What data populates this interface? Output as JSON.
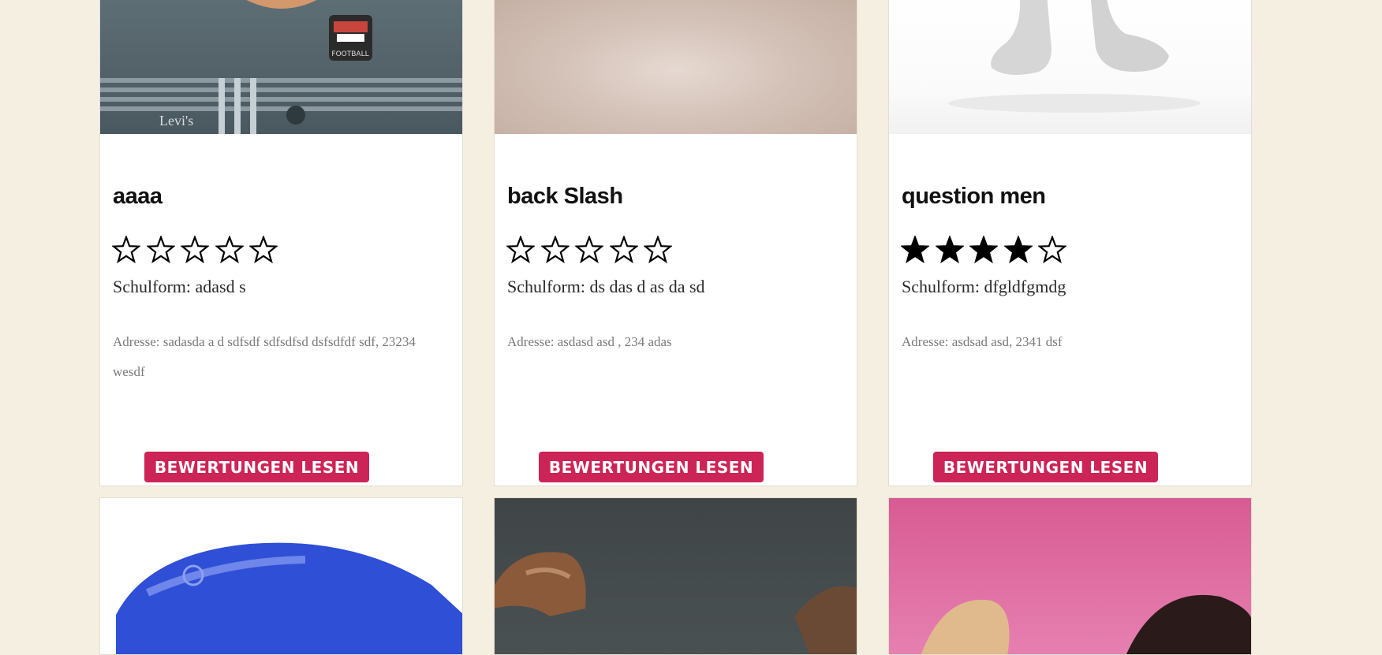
{
  "colors": {
    "background": "#f5efe1",
    "button": "#cc2456",
    "star": "#000000"
  },
  "cards": [
    {
      "title": "aaaa",
      "rating": 0,
      "max_rating": 5,
      "schulform": "Schulform: adasd s",
      "adresse": "Adresse: sadasda a d  sdfsdf sdfsdfsd dsfsdfdf sdf, 23234 wesdf",
      "button_label": "BEWERTUNGEN LESEN"
    },
    {
      "title": "back Slash",
      "rating": 0,
      "max_rating": 5,
      "schulform": "Schulform: ds das d as da sd",
      "adresse": "Adresse: asdasd asd , 234 adas",
      "button_label": "BEWERTUNGEN LESEN"
    },
    {
      "title": "question men",
      "rating": 4,
      "max_rating": 5,
      "schulform": "Schulform: dfgldfgmdg",
      "adresse": "Adresse: asdsad asd, 2341 dsf",
      "button_label": "BEWERTUNGEN LESEN"
    }
  ],
  "photo_texts": {
    "shirt_brand": "Levi's",
    "shirt_print": "FOOTBALL"
  }
}
